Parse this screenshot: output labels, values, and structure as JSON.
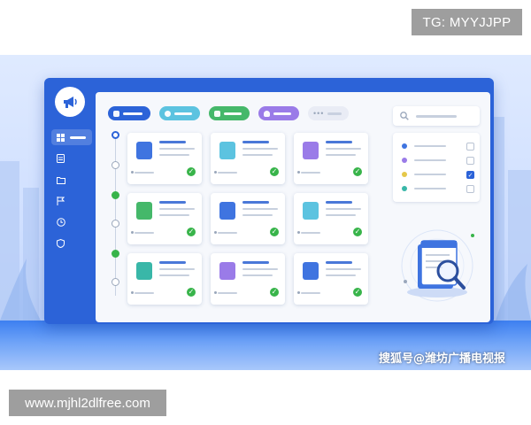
{
  "watermarks": {
    "top_right": "TG: MYYJJPP",
    "bottom_left": "www.mjhl2dlfree.com",
    "caption": "搜狐号@潍坊广播电视报"
  },
  "colors": {
    "brand": "#2c63d8",
    "success": "#38b44a",
    "sidebar": "#2c63d8",
    "panel": "#f6f8fc"
  },
  "sidebar": {
    "logo_icon": "megaphone-icon",
    "items": [
      {
        "icon": "grid-icon",
        "active": true
      },
      {
        "icon": "document-icon",
        "active": false
      },
      {
        "icon": "folder-icon",
        "active": false
      },
      {
        "icon": "flag-icon",
        "active": false
      },
      {
        "icon": "clock-icon",
        "active": false
      },
      {
        "icon": "shield-icon",
        "active": false
      }
    ]
  },
  "filter_chips": [
    {
      "icon": "grid-icon",
      "color": "#2c63d8"
    },
    {
      "icon": "person-icon",
      "color": "#5cc3e0"
    },
    {
      "icon": "grid-icon",
      "color": "#45b86a"
    },
    {
      "icon": "bell-icon",
      "color": "#9a7be8"
    },
    {
      "icon": "more-icon",
      "color": "#e9ecf5"
    }
  ],
  "timeline": [
    "current",
    "pending",
    "done",
    "pending",
    "done",
    "pending"
  ],
  "cards": [
    {
      "icon": "document-icon",
      "color": "#3f74e0",
      "done": true
    },
    {
      "icon": "bank-icon",
      "color": "#5cc3e0",
      "done": true
    },
    {
      "icon": "megaphone-icon",
      "color": "#9a7be8",
      "done": true
    },
    {
      "icon": "leaf-icon",
      "color": "#45b86a",
      "done": true
    },
    {
      "icon": "shield-icon",
      "color": "#3f74e0",
      "done": true
    },
    {
      "icon": "person-card-icon",
      "color": "#5cc3e0",
      "done": true
    },
    {
      "icon": "bar-chart-icon",
      "color": "#39b7a8",
      "done": true
    },
    {
      "icon": "clipboard-icon",
      "color": "#9a7be8",
      "done": true
    },
    {
      "icon": "book-icon",
      "color": "#3f74e0",
      "done": true
    }
  ],
  "right_panel": {
    "search_icon": "search-icon",
    "filters": [
      {
        "color": "#3f74e0",
        "checked": false
      },
      {
        "color": "#9a7be8",
        "checked": false
      },
      {
        "color": "#e5c84a",
        "checked": true
      },
      {
        "color": "#39b7a8",
        "checked": false
      }
    ],
    "illustration_icon": "document-magnifier-icon"
  }
}
